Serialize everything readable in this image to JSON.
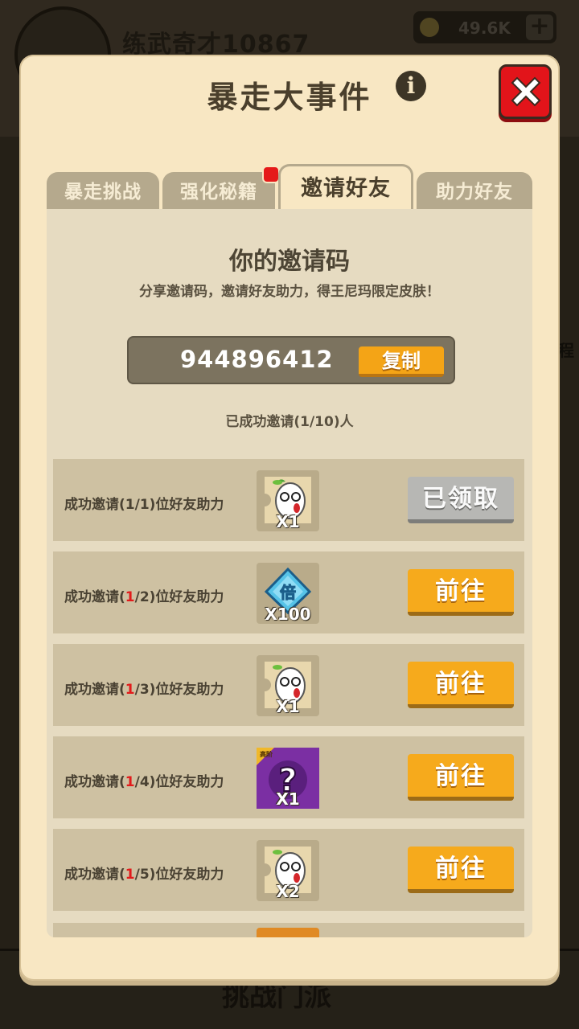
{
  "background": {
    "player_name": "练武奇才10867",
    "coins": "49.6K",
    "bottom_title": "挑战门派",
    "side_text": "程"
  },
  "dialog": {
    "title": "暴走大事件",
    "info_icon": "info-icon",
    "close_icon": "close-x-icon"
  },
  "tabs": [
    {
      "label": "暴走挑战",
      "active": false
    },
    {
      "label": "强化秘籍",
      "active": false,
      "badge": true
    },
    {
      "label": "邀请好友",
      "active": true
    },
    {
      "label": "助力好友",
      "active": false
    }
  ],
  "invite": {
    "title": "你的邀请码",
    "subtitle": "分享邀请码，邀请好友助力，得王尼玛限定皮肤！",
    "code": "944896412",
    "copy_label": "复制",
    "progress_text": "已成功邀请(1/10)人"
  },
  "rows": [
    {
      "prefix": "成功邀请(",
      "current": "1",
      "rest": "/1)位好友助力",
      "current_red": false,
      "reward_icon": "wangnima-fragment-icon",
      "qty": "X1",
      "button": "已领取",
      "claimed": true
    },
    {
      "prefix": "成功邀请(",
      "current": "1",
      "rest": "/2)位好友助力",
      "current_red": true,
      "reward_icon": "multiplier-diamond-icon",
      "reward_glyph": "倍",
      "qty": "X100",
      "button": "前往",
      "claimed": false
    },
    {
      "prefix": "成功邀请(",
      "current": "1",
      "rest": "/3)位好友助力",
      "current_red": true,
      "reward_icon": "wangnima-fragment-icon",
      "qty": "X1",
      "button": "前往",
      "claimed": false
    },
    {
      "prefix": "成功邀请(",
      "current": "1",
      "rest": "/4)位好友助力",
      "current_red": true,
      "reward_icon": "mystery-box-icon",
      "reward_tag": "高阶",
      "qty": "X1",
      "button": "前往",
      "claimed": false
    },
    {
      "prefix": "成功邀请(",
      "current": "1",
      "rest": "/5)位好友助力",
      "current_red": true,
      "reward_icon": "wangnima-fragment-icon",
      "qty": "X2",
      "button": "前往",
      "claimed": false
    }
  ]
}
